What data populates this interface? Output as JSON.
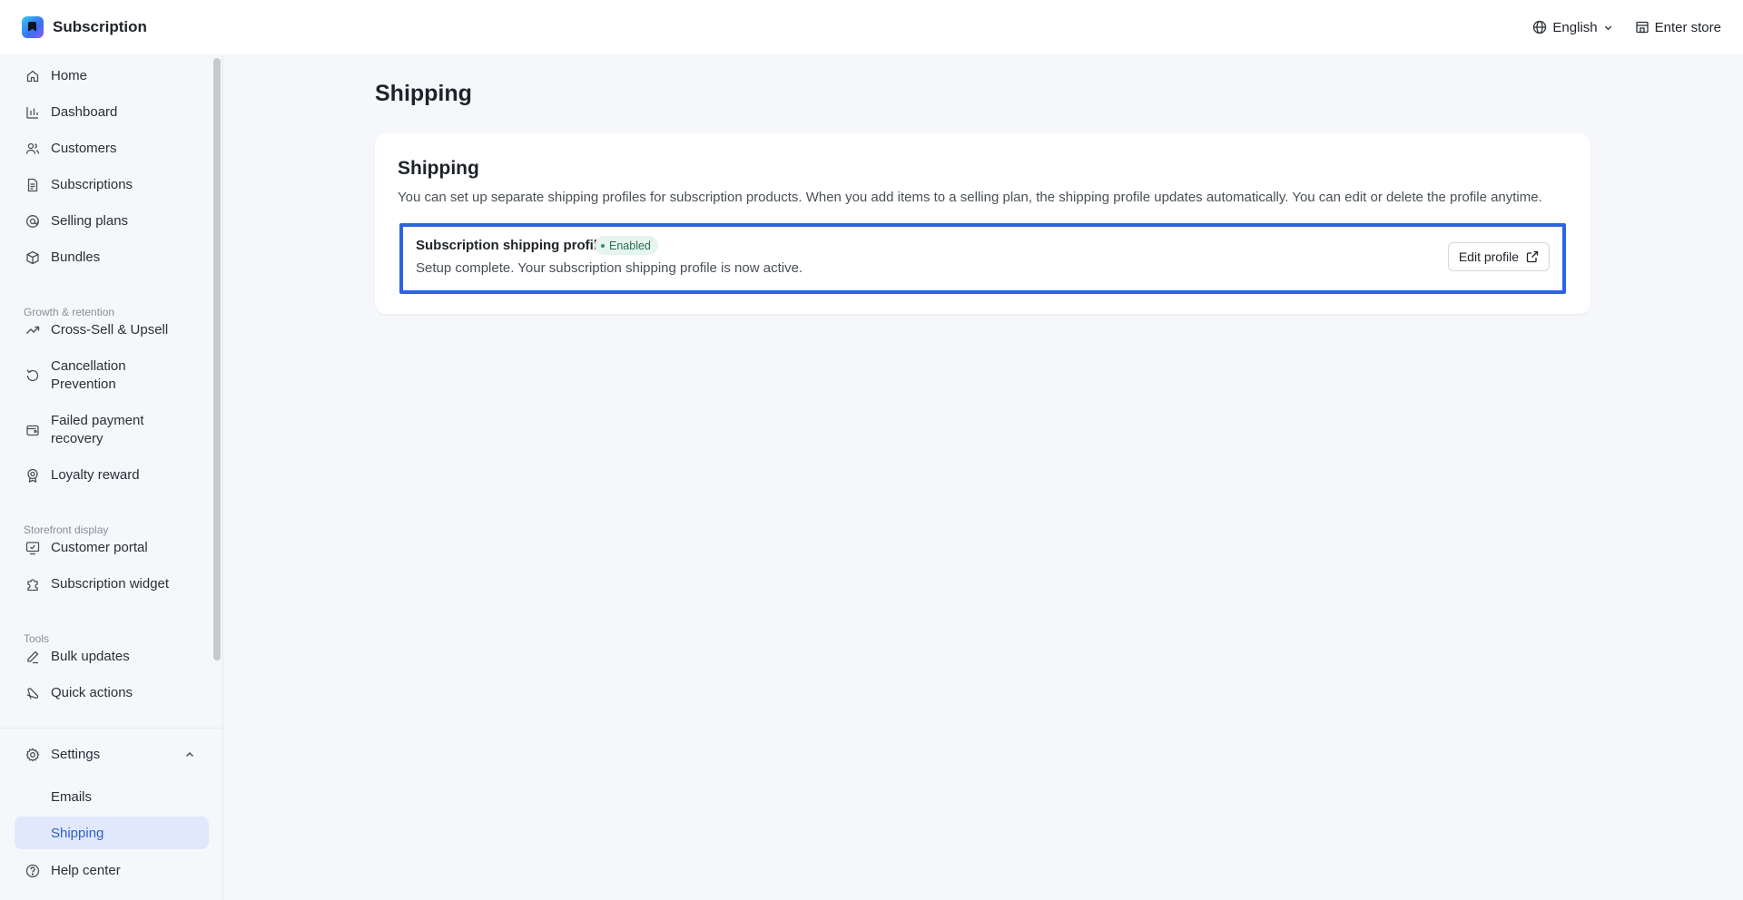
{
  "app": {
    "title": "Subscription"
  },
  "topbar": {
    "language": "English",
    "enter_store": "Enter store"
  },
  "sidebar": {
    "items": [
      {
        "label": "Home",
        "icon": "home-icon"
      },
      {
        "label": "Dashboard",
        "icon": "bar-chart-icon"
      },
      {
        "label": "Customers",
        "icon": "users-icon"
      },
      {
        "label": "Subscriptions",
        "icon": "document-icon"
      },
      {
        "label": "Selling plans",
        "icon": "tag-icon"
      },
      {
        "label": "Bundles",
        "icon": "box-icon"
      }
    ],
    "section_growth": "Growth & retention",
    "growth_items": [
      {
        "label": "Cross-Sell & Upsell",
        "icon": "trending-up-icon"
      },
      {
        "label": "Cancellation Prevention",
        "icon": "rotate-icon"
      },
      {
        "label": "Failed payment recovery",
        "icon": "wallet-icon"
      },
      {
        "label": "Loyalty reward",
        "icon": "award-icon"
      }
    ],
    "section_storefront": "Storefront display",
    "storefront_items": [
      {
        "label": "Customer portal",
        "icon": "monitor-icon"
      },
      {
        "label": "Subscription widget",
        "icon": "puzzle-icon"
      }
    ],
    "section_tools": "Tools",
    "tools_items": [
      {
        "label": "Bulk updates",
        "icon": "pen-icon"
      },
      {
        "label": "Quick actions",
        "icon": "zap-icon"
      }
    ],
    "settings": {
      "label": "Settings",
      "sub_items": [
        {
          "label": "Emails"
        },
        {
          "label": "Shipping",
          "active": true
        }
      ]
    },
    "help": "Help center"
  },
  "main": {
    "page_title": "Shipping",
    "card": {
      "title": "Shipping",
      "description": "You can set up separate shipping profiles for subscription products. When you add items to a selling plan, the shipping profile updates automatically. You can edit or delete the profile anytime.",
      "profile": {
        "name": "Subscription shipping profile",
        "status": "Enabled",
        "status_color": "#2f8f69",
        "subtitle": "Setup complete. Your subscription shipping profile is now active.",
        "edit_label": "Edit profile"
      }
    }
  },
  "colors": {
    "accent": "#2c63e0",
    "active_bg": "#e0e8fb"
  }
}
